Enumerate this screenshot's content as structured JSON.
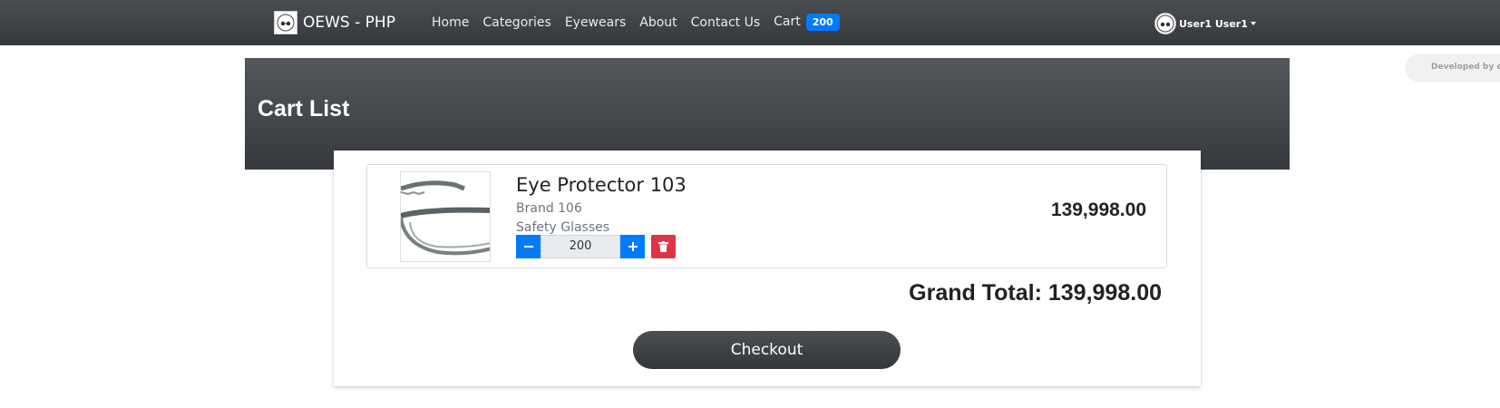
{
  "navbar": {
    "brand": "OEWS - PHP",
    "links": [
      "Home",
      "Categories",
      "Eyewears",
      "About",
      "Contact Us"
    ],
    "cart_label": "Cart",
    "cart_count": "200",
    "user_name": "User1 User1"
  },
  "dev_note": "Developed by ore",
  "page": {
    "title": "Cart List"
  },
  "cart": {
    "items": [
      {
        "name": "Eye Protector 103",
        "brand": "Brand 106",
        "category": "Safety Glasses",
        "quantity": "200",
        "price": "139,998.00"
      }
    ],
    "grand_total_label": "Grand Total:",
    "grand_total": "139,998.00",
    "checkout_label": "Checkout"
  },
  "colors": {
    "primary": "#007bff",
    "danger": "#dc3545",
    "dark": "#343a40"
  }
}
